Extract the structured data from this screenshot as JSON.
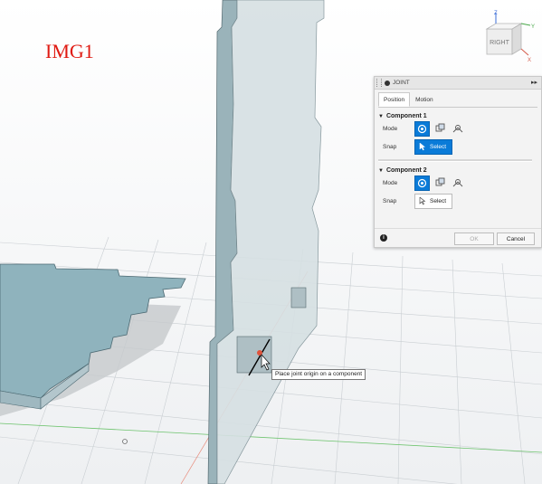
{
  "overlay_label": "IMG1",
  "viewcube": {
    "face_label": "RIGHT",
    "axis_z": "Z",
    "axis_x": "X",
    "axis_y": "Y"
  },
  "joint_panel": {
    "title": "JOINT",
    "tabs": [
      {
        "label": "Position",
        "active": true
      },
      {
        "label": "Motion",
        "active": false
      }
    ],
    "component1": {
      "title": "Component 1",
      "mode_label": "Mode",
      "snap_label": "Snap",
      "select_label": "Select",
      "select_active": true
    },
    "component2": {
      "title": "Component 2",
      "mode_label": "Mode",
      "snap_label": "Snap",
      "select_label": "Select",
      "select_active": false
    },
    "ok_label": "OK",
    "cancel_label": "Cancel"
  },
  "tooltip": "Place joint origin on a component",
  "colors": {
    "accent": "#0a7bd8",
    "label_red": "#e01a12",
    "plate": "#8fb3bd"
  }
}
